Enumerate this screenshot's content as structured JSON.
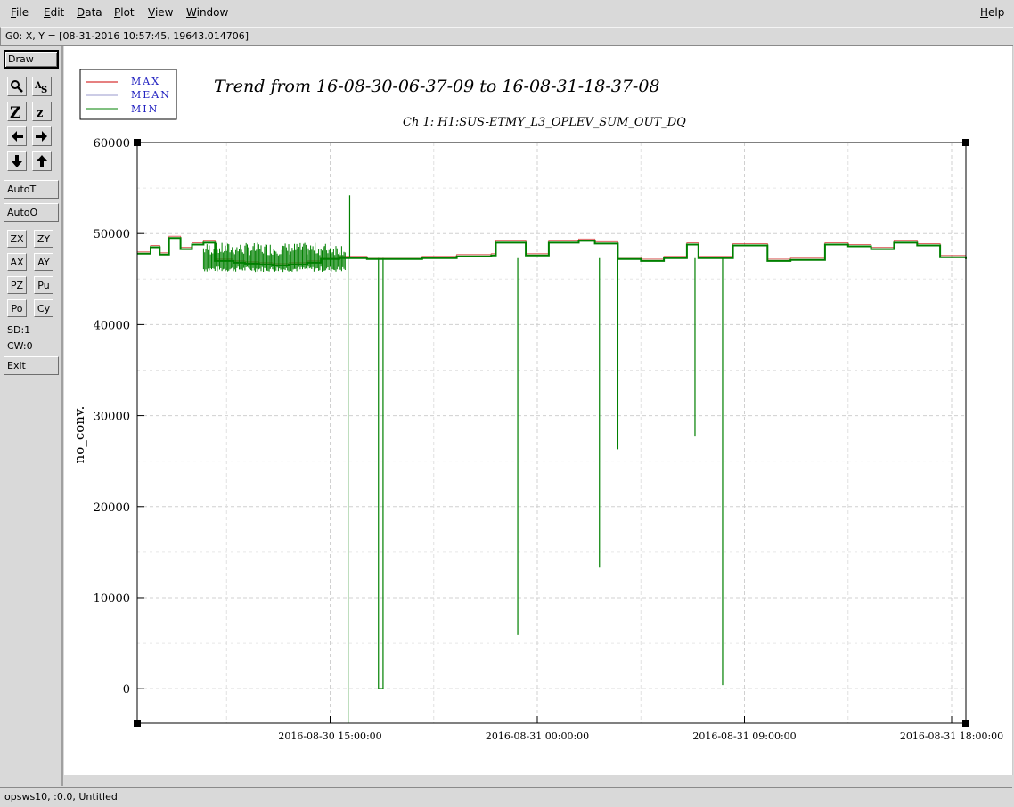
{
  "menu": {
    "file": "File",
    "edit": "Edit",
    "data": "Data",
    "plot": "Plot",
    "view": "View",
    "window": "Window",
    "help": "Help"
  },
  "status": {
    "coords": "G0: X, Y = [08-31-2016 10:57:45, 19643.014706]",
    "bottom": "opsws10, :0.0, Untitled"
  },
  "toolbar": {
    "draw": "Draw",
    "autot": "AutoT",
    "autoo": "AutoO",
    "zx": "ZX",
    "zy": "ZY",
    "ax": "AX",
    "ay": "AY",
    "pz": "PZ",
    "pu": "Pu",
    "po": "Po",
    "cy": "Cy",
    "sd": "SD:1",
    "cw": "CW:0",
    "exit": "Exit"
  },
  "chart_data": {
    "type": "line",
    "title": "Trend from 16-08-30-06-37-09 to 16-08-31-18-37-08",
    "subtitle": "Ch 1: H1:SUS-ETMY_L3_OPLEV_SUM_OUT_DQ",
    "ylabel": "no_conv.",
    "xlabel": "",
    "ylim": [
      -3800,
      60000
    ],
    "yticks": [
      "60000",
      "50000",
      "40000",
      "30000",
      "20000",
      "10000",
      "0"
    ],
    "xticks": [
      "2016-08-30 15:00:00",
      "2016-08-31 00:00:00",
      "2016-08-31 09:00:00",
      "2016-08-31 18:00:00"
    ],
    "xrange_hours": [
      6.619,
      42.619
    ],
    "grid": true,
    "legend_position": "top-left",
    "series": [
      {
        "name": "MAX",
        "color": "#cc0000"
      },
      {
        "name": "MEAN",
        "color": "#9999cc"
      },
      {
        "name": "MIN",
        "color": "#008000"
      }
    ],
    "min_series": {
      "hours": [
        6.62,
        7.2,
        7.6,
        8.0,
        8.5,
        9.0,
        9.5,
        10.0,
        10.8,
        11.3,
        11.9,
        12.5,
        13.2,
        14.0,
        14.6,
        15.4,
        15.9,
        16.6,
        17.5,
        19.0,
        20.5,
        22.0,
        22.2,
        23.5,
        24.5,
        25.8,
        26.5,
        27.5,
        28.5,
        29.5,
        30.5,
        31.0,
        32.5,
        34.0,
        35.0,
        36.5,
        37.5,
        38.5,
        39.5,
        40.5,
        41.5,
        42.62
      ],
      "values": [
        47800,
        48500,
        47700,
        49500,
        48300,
        48800,
        49000,
        47000,
        46800,
        46700,
        46600,
        46500,
        46600,
        46800,
        47200,
        47300,
        47300,
        47200,
        47200,
        47300,
        47500,
        47600,
        49000,
        47600,
        49000,
        49200,
        48900,
        47200,
        47000,
        47300,
        48800,
        47300,
        48700,
        47000,
        47100,
        48800,
        48600,
        48300,
        49000,
        48700,
        47400,
        47200
      ]
    },
    "dips": [
      {
        "hour": 15.78,
        "value": -3800
      },
      {
        "hour": 15.85,
        "value": 54200
      },
      {
        "hour": 17.1,
        "value": 0
      },
      {
        "hour": 17.3,
        "value": 0
      },
      {
        "hour": 23.15,
        "value": 5900
      },
      {
        "hour": 26.7,
        "value": 13300
      },
      {
        "hour": 27.5,
        "value": 26300
      },
      {
        "hour": 30.85,
        "value": 27700
      },
      {
        "hour": 32.05,
        "value": 400
      }
    ]
  }
}
